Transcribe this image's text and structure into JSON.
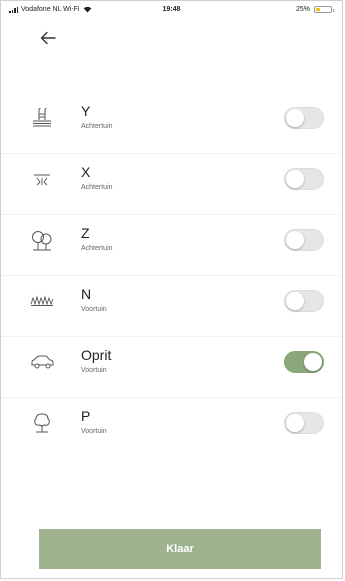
{
  "status_bar": {
    "carrier": "Vodafone NL Wi-Fi",
    "time": "19:48",
    "battery_percent": "25%",
    "battery_level": 0.25,
    "battery_color": "#f1c400"
  },
  "back_icon": "arrow-left-icon",
  "items": [
    {
      "title": "Y",
      "subtitle": "Achtertuin",
      "icon": "pool-ladder-icon",
      "enabled": false
    },
    {
      "title": "X",
      "subtitle": "Achtertuin",
      "icon": "sprinkler-icon",
      "enabled": false
    },
    {
      "title": "Z",
      "subtitle": "Achtertuin",
      "icon": "trees-icon",
      "enabled": false
    },
    {
      "title": "N",
      "subtitle": "Voortuin",
      "icon": "grass-icon",
      "enabled": false
    },
    {
      "title": "Oprit",
      "subtitle": "Voortuin",
      "icon": "driveway-car-icon",
      "enabled": true
    },
    {
      "title": "P",
      "subtitle": "Voortuin",
      "icon": "tree-icon",
      "enabled": false
    }
  ],
  "button": {
    "label": "Klaar"
  },
  "colors": {
    "accent": "#8aa77a",
    "button": "#9fb38f",
    "toggle_off": "#e6e6e6"
  }
}
